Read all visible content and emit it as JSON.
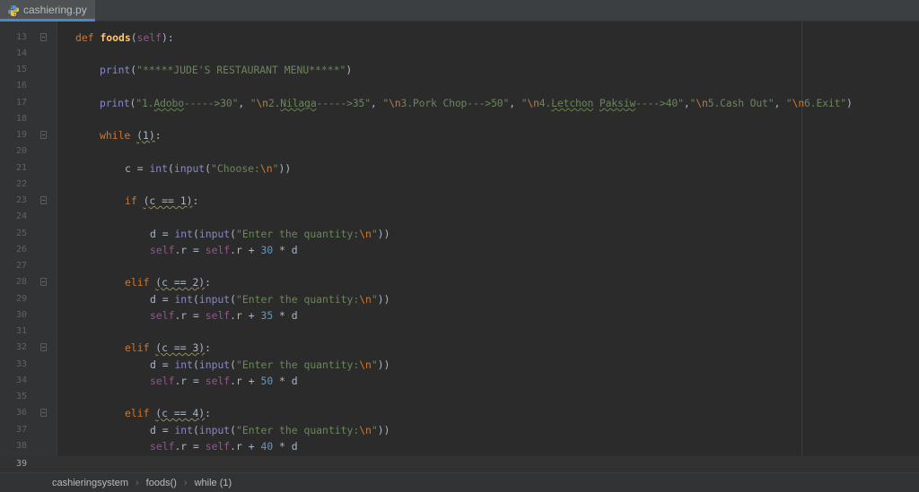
{
  "tab": {
    "filename": "cashiering.py",
    "icon": "python-file-icon"
  },
  "breadcrumb": {
    "items": [
      "cashieringsystem",
      "foods()",
      "while (1)"
    ],
    "separator": "›"
  },
  "editor": {
    "current_line": 39,
    "line_numbers": [
      "13",
      "14",
      "15",
      "16",
      "17",
      "18",
      "19",
      "20",
      "21",
      "22",
      "23",
      "24",
      "25",
      "26",
      "27",
      "28",
      "29",
      "30",
      "31",
      "32",
      "33",
      "34",
      "35",
      "36",
      "37",
      "38",
      "39"
    ],
    "tokens": {
      "kw_def": "def",
      "fn_foods": "foods",
      "self": "self",
      "print": "print",
      "str_menu": "\"*****JUDE'S RESTAURANT MENU*****\"",
      "s1a": "\"1.",
      "s1b": "Adobo",
      "s1c": "----->30\"",
      "s2a": "\"",
      "s2esc": "\\n",
      "s2b": "2.",
      "s2c": "Nilaga",
      "s2d": "----->35\"",
      "s3a": "\"",
      "s3esc": "\\n",
      "s3b": "3.Pork Chop--->50\"",
      "s4a": "\"",
      "s4esc": "\\n",
      "s4b": "4.",
      "s4c": "Letchon",
      "s4d": " ",
      "s4e": "Paksiw",
      "s4f": "---->40\"",
      "s5a": "\"",
      "s5esc": "\\n",
      "s5b": "5.Cash Out\"",
      "s6a": "\"",
      "s6esc": "\\n",
      "s6b": "6.Exit\"",
      "kw_while": "while",
      "while_cond": "(1)",
      "var_c": "c",
      "var_d": "d",
      "int": "int",
      "input": "input",
      "str_choose": "\"Choose:",
      "esc_n": "\\n",
      "quote": "\"",
      "str_qty": "\"Enter the quantity:",
      "kw_if": "if",
      "kw_elif": "elif",
      "cond1": "(c == 1)",
      "cond2": "(c == 2)",
      "cond3": "(c == 3)",
      "cond4": "(c == 4)",
      "attr_r": ".r",
      "num30": "30",
      "num35": "35",
      "num50": "50",
      "num40": "40"
    }
  }
}
